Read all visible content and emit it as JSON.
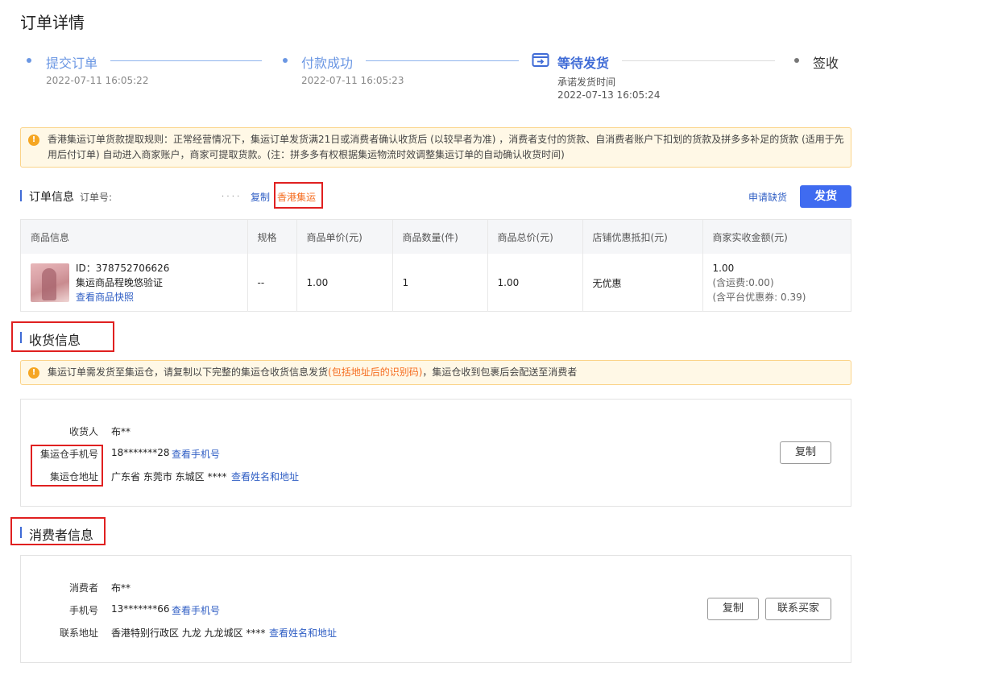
{
  "page": {
    "title": "订单详情"
  },
  "steps": [
    {
      "label": "提交订单",
      "time": "2022-07-11 16:05:22"
    },
    {
      "label": "付款成功",
      "time": "2022-07-11 16:05:23"
    },
    {
      "label": "等待发货",
      "sub": "承诺发货时间",
      "time": "2022-07-13 16:05:24"
    },
    {
      "label": "签收"
    }
  ],
  "notice1": "香港集运订单货款提取规则：正常经营情况下，集运订单发货满21日或消费者确认收货后 (以较早者为准) ，消费者支付的货款、自消费者账户下扣划的货款及拼多多补足的货款 (适用于先用后付订单) 自动进入商家账户，商家可提取货款。(注：拼多多有权根据集运物流时效调整集运订单的自动确认收货时间)",
  "order": {
    "section_title": "订单信息",
    "order_no_label": "订单号:",
    "order_no_value": ". . . .",
    "copy": "复制",
    "tag": "香港集运",
    "apply_shortage": "申请缺货",
    "ship": "发货"
  },
  "goods_table": {
    "headers": [
      "商品信息",
      "规格",
      "商品单价(元)",
      "商品数量(件)",
      "商品总价(元)",
      "店铺优惠抵扣(元)",
      "商家实收金额(元)"
    ],
    "row": {
      "id": "ID：378752706626",
      "name": "集运商品程晚悠验证",
      "snapshot": "查看商品快照",
      "spec": "--",
      "unit_price": "1.00",
      "qty": "1",
      "total": "1.00",
      "discount": "无优惠",
      "received": "1.00",
      "shipping_fee": "(含运费:0.00)",
      "platform_coupon": "(含平台优惠券: 0.39)"
    }
  },
  "shipping": {
    "section_title": "收货信息",
    "notice_pre": "集运订单需发货至集运仓，请复制以下完整的集运仓收货信息发货",
    "notice_highlight": "(包括地址后的识别码)",
    "notice_post": "，集运仓收到包裹后会配送至消费者",
    "receiver_label": "收货人",
    "receiver_value": "布**",
    "phone_label": "集运仓手机号",
    "phone_value": "18*******28",
    "phone_link": "查看手机号",
    "address_label": "集运仓地址",
    "address_value": "广东省 东莞市 东城区 ****",
    "address_link": "查看姓名和地址",
    "copy": "复制"
  },
  "consumer": {
    "section_title": "消费者信息",
    "name_label": "消费者",
    "name_value": "布**",
    "phone_label": "手机号",
    "phone_value": "13*******66",
    "phone_link": "查看手机号",
    "address_label": "联系地址",
    "address_value": "香港特别行政区 九龙 九龙城区 ****",
    "address_link": "查看姓名和地址",
    "copy": "复制",
    "contact": "联系买家"
  }
}
